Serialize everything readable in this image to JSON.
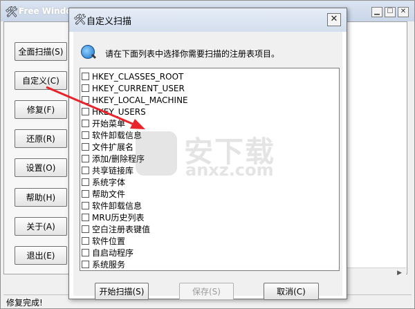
{
  "main_window": {
    "title": "Free Window",
    "side_buttons": [
      "全面扫描(S)",
      "自定义(C)",
      "修复(F)",
      "还原(R)",
      "设置(O)",
      "帮助(H)",
      "关于(A)",
      "退出(E)"
    ],
    "status": "修复完成!"
  },
  "dialog": {
    "title": "自定义扫描",
    "close_glyph": "✕",
    "instruction": "请在下面列表中选择你需要扫描的注册表项目。",
    "items": [
      {
        "label": "HKEY_CLASSES_ROOT",
        "checked": false
      },
      {
        "label": "HKEY_CURRENT_USER",
        "checked": false
      },
      {
        "label": "HKEY_LOCAL_MACHINE",
        "checked": false
      },
      {
        "label": "HKEY_USERS",
        "checked": false
      },
      {
        "label": "开始菜单",
        "checked": false
      },
      {
        "label": "软件卸载信息",
        "checked": false
      },
      {
        "label": "文件扩展名",
        "checked": false
      },
      {
        "label": "添加/删除程序",
        "checked": false
      },
      {
        "label": "共享链接库",
        "checked": false
      },
      {
        "label": "系统字体",
        "checked": false
      },
      {
        "label": "帮助文件",
        "checked": false
      },
      {
        "label": "软件卸载信息",
        "checked": false
      },
      {
        "label": "MRU历史列表",
        "checked": false
      },
      {
        "label": "空白注册表键值",
        "checked": false
      },
      {
        "label": "软件位置",
        "checked": false
      },
      {
        "label": "自启动程序",
        "checked": false
      },
      {
        "label": "系统服务",
        "checked": false
      }
    ],
    "buttons": {
      "start": "开始扫描(S)",
      "save": "保存(S)",
      "cancel": "取消(C)"
    }
  },
  "watermark": {
    "cn": "安下载",
    "en": "anxz.com"
  },
  "colors": {
    "arrow": "#e8242a",
    "accent": "#1d6fc3"
  }
}
